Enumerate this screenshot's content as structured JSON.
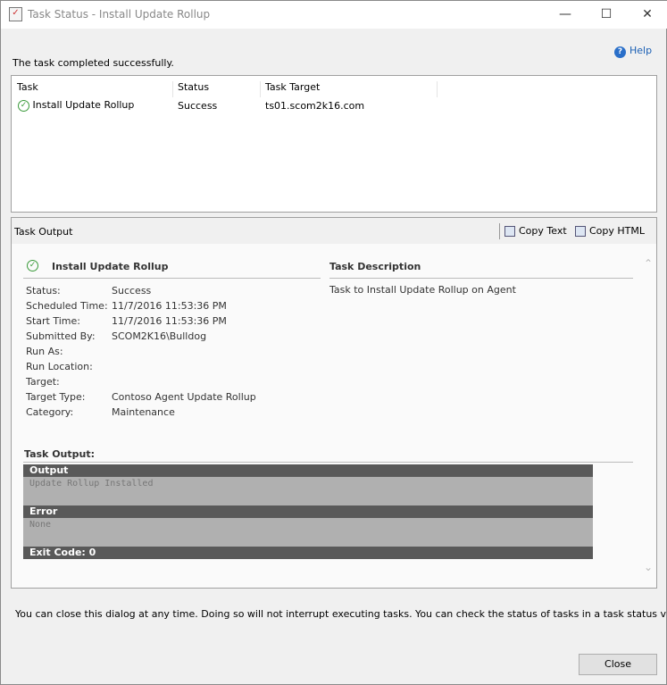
{
  "window": {
    "title": "Task Status - Install Update Rollup",
    "controls": {
      "minimize": "—",
      "maximize": "☐",
      "close": "✕"
    }
  },
  "help_label": "Help",
  "status_message": "The task completed successfully.",
  "task_list": {
    "columns": [
      "Task",
      "Status",
      "Task Target"
    ],
    "rows": [
      {
        "task": "Install Update Rollup",
        "status": "Success",
        "target": "ts01.scom2k16.com"
      }
    ]
  },
  "output_panel": {
    "title": "Task Output",
    "copy_text": "Copy Text",
    "copy_html": "Copy HTML",
    "task_name": "Install Update Rollup",
    "description_heading": "Task Description",
    "description": "Task to Install Update Rollup on Agent",
    "fields": [
      {
        "label": "Status:",
        "value": "Success"
      },
      {
        "label": "Scheduled Time:",
        "value": "11/7/2016 11:53:36 PM"
      },
      {
        "label": "Start Time:",
        "value": "11/7/2016 11:53:36 PM"
      },
      {
        "label": "Submitted By:",
        "value": "SCOM2K16\\Bulldog"
      },
      {
        "label": "Run As:",
        "value": ""
      },
      {
        "label": "Run Location:",
        "value": ""
      },
      {
        "label": "Target:",
        "value": ""
      },
      {
        "label": "Target Type:",
        "value": "Contoso Agent Update Rollup"
      },
      {
        "label": "Category:",
        "value": "Maintenance"
      }
    ],
    "task_output_heading": "Task Output:",
    "output_header": "Output",
    "output_text": "Update Rollup Installed",
    "error_header": "Error",
    "error_text": "None",
    "exit_code": "Exit Code: 0"
  },
  "footer_note": "You can close this dialog at any time. Doing so will not interrupt executing tasks. You can check the status of tasks in a task status view.",
  "close_label": "Close"
}
